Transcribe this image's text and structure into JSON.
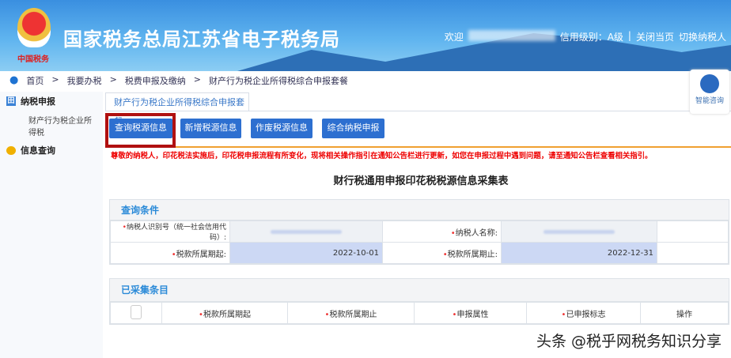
{
  "header": {
    "title": "国家税务总局江苏省电子税务局",
    "logo_text": "中国税务",
    "welcome": "欢迎",
    "credit": "信用级别：A级",
    "close": "关闭当页",
    "switch": "切换纳税人"
  },
  "breadcrumb": [
    "首页",
    "我要办税",
    "税费申报及缴纳",
    "财产行为税企业所得税综合申报套餐"
  ],
  "sidebar": {
    "groups": [
      {
        "label": "纳税申报",
        "items": [
          "财产行为税企业所得税"
        ]
      },
      {
        "label": "信息查询",
        "items": []
      }
    ]
  },
  "tab": "财产行为税企业所得税综合申报套餐",
  "buttons": [
    "查询税源信息",
    "新增税源信息",
    "作废税源信息",
    "综合纳税申报"
  ],
  "notice": "尊敬的纳税人，印花税法实施后，印花税申报流程有所变化，现将相关操作指引在通知公告栏进行更新，如您在申报过程中遇到问题，请至通知公告栏查看相关指引。",
  "form_title": "财行税通用申报印花税税源信息采集表",
  "query": {
    "title": "查询条件",
    "taxpayer_id_label": "纳税人识别号（统一社会信用代码）:",
    "taxpayer_name_label": "纳税人名称:",
    "start_label": "税款所属期起:",
    "start_value": "2022-10-01",
    "end_label": "税款所属期止:",
    "end_value": "2022-12-31"
  },
  "collected": {
    "title": "已采集条目",
    "columns": [
      "税款所属期起",
      "税款所属期止",
      "申报属性",
      "已申报标志",
      "操作"
    ]
  },
  "assistant": "智能咨询",
  "watermark": "头条 @税乎网税务知识分享"
}
